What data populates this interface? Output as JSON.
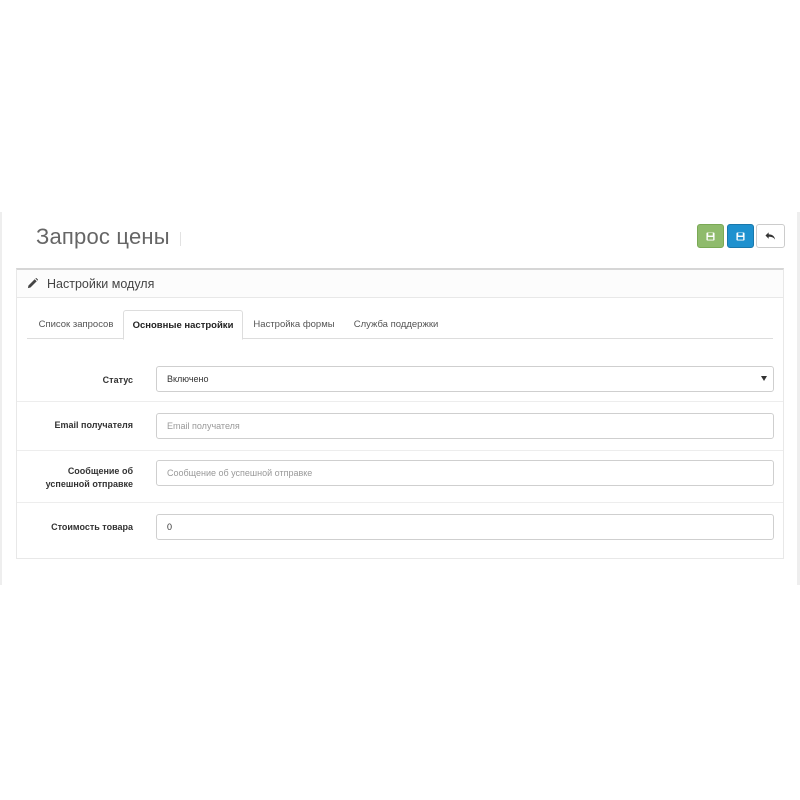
{
  "header": {
    "title": "Запрос цены",
    "buttons": [
      {
        "name": "save-stay",
        "icon": "floppy-disk-icon",
        "color": "#8fbb6c"
      },
      {
        "name": "save",
        "icon": "floppy-disk-icon",
        "color": "#1e91cf"
      },
      {
        "name": "back",
        "icon": "reply-arrow-icon",
        "color": "#ffffff"
      }
    ]
  },
  "panel": {
    "icon": "pencil-icon",
    "title": "Настройки модуля"
  },
  "tabs": [
    {
      "label": "Список запросов",
      "active": false
    },
    {
      "label": "Основные настройки",
      "active": true
    },
    {
      "label": "Настройка формы",
      "active": false
    },
    {
      "label": "Служба поддержки",
      "active": false
    }
  ],
  "form": {
    "status": {
      "label": "Статус",
      "value": "Включено"
    },
    "email": {
      "label": "Email получателя",
      "placeholder": "Email получателя",
      "value": ""
    },
    "success_message": {
      "label_line1": "Сообщение об",
      "label_line2": "успешной отправке",
      "placeholder": "Сообщение об успешной отправке",
      "value": ""
    },
    "price": {
      "label": "Стоимость товара",
      "value": "0"
    }
  }
}
